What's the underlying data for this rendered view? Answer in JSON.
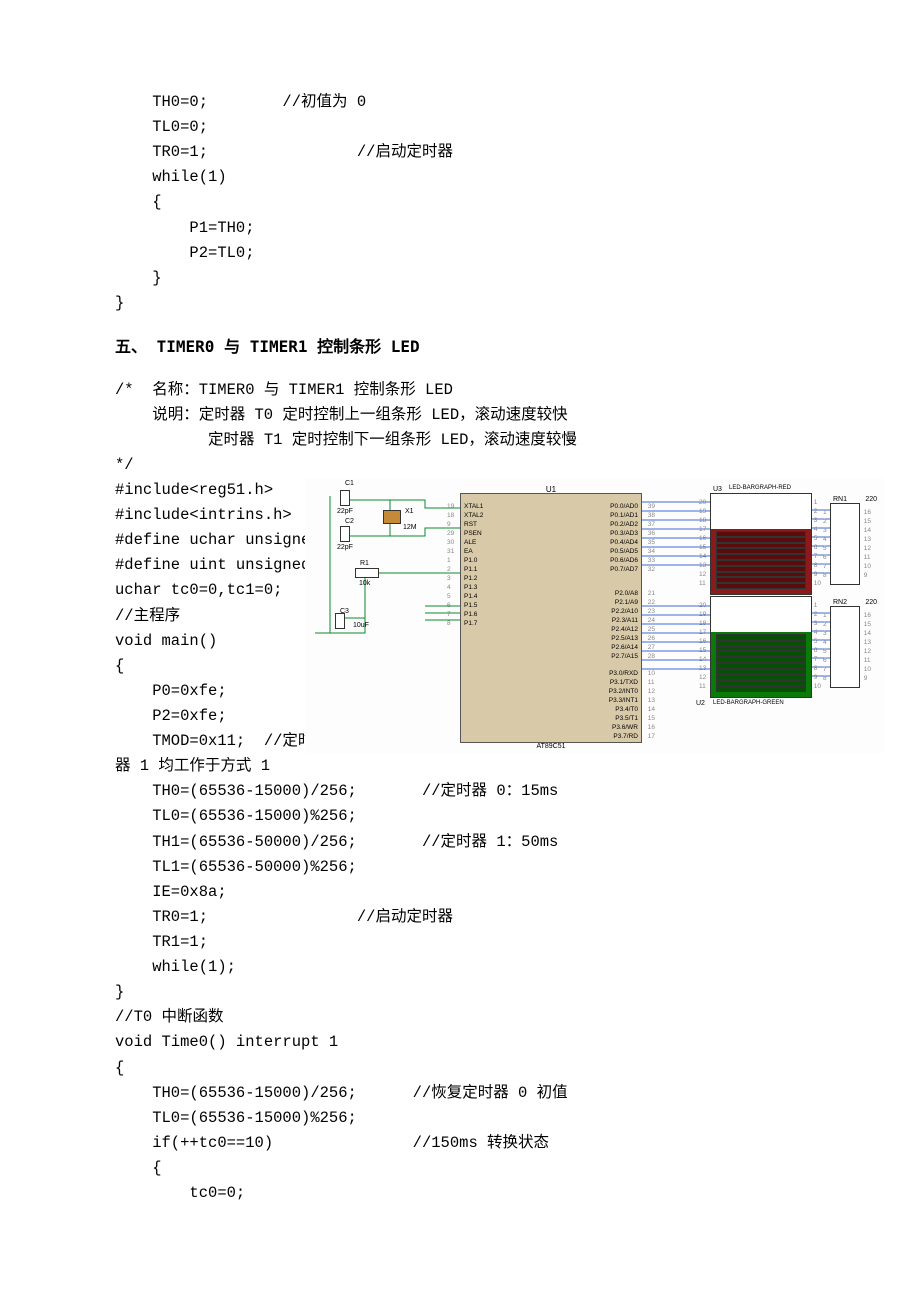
{
  "code_top": "    TH0=0;        //初值为 0\n    TL0=0;\n    TR0=1;                //启动定时器\n    while(1)\n    {\n        P1=TH0;\n        P2=TL0;\n    }\n}",
  "heading": "五、  TIMER0 与 TIMER1 控制条形 LED",
  "code_header": "/*  名称：TIMER0 与 TIMER1 控制条形 LED\n    说明：定时器 T0 定时控制上一组条形 LED，滚动速度较快\n          定时器 T1 定时控制下一组条形 LED，滚动速度较慢\n*/",
  "code_mid_left": "#include<reg51.h>\n#include<intrins.h>\n#define uchar unsigned char\n#define uint unsigned int\nuchar tc0=0,tc1=0;\n//主程序\nvoid main()\n{\n    P0=0xfe;\n    P2=0xfe;\n    TMOD=0x11;  //定时器 0、定时\n器 1 均工作于方式 1",
  "code_bottom": "    TH0=(65536-15000)/256;       //定时器 0：15ms\n    TL0=(65536-15000)%256;\n    TH1=(65536-50000)/256;       //定时器 1：50ms\n    TL1=(65536-50000)%256;\n    IE=0x8a;\n    TR0=1;                //启动定时器\n    TR1=1;\n    while(1);\n}\n//T0 中断函数\nvoid Time0() interrupt 1\n{\n    TH0=(65536-15000)/256;      //恢复定时器 0 初值\n    TL0=(65536-15000)%256;\n    if(++tc0==10)               //150ms 转换状态\n    {\n        tc0=0;",
  "schematic": {
    "mcu": {
      "ref": "U1",
      "name": "AT89C51",
      "pins_left": [
        {
          "num": "19",
          "lbl": "XTAL1"
        },
        {
          "num": "",
          "lbl": ""
        },
        {
          "num": "18",
          "lbl": "XTAL2"
        },
        {
          "num": "",
          "lbl": ""
        },
        {
          "num": "",
          "lbl": ""
        },
        {
          "num": "9",
          "lbl": "RST"
        },
        {
          "num": "",
          "lbl": ""
        },
        {
          "num": "",
          "lbl": ""
        },
        {
          "num": "29",
          "lbl": "PSEN"
        },
        {
          "num": "30",
          "lbl": "ALE"
        },
        {
          "num": "31",
          "lbl": "EA"
        },
        {
          "num": "",
          "lbl": ""
        },
        {
          "num": "",
          "lbl": ""
        },
        {
          "num": "1",
          "lbl": "P1.0"
        },
        {
          "num": "2",
          "lbl": "P1.1"
        },
        {
          "num": "3",
          "lbl": "P1.2"
        },
        {
          "num": "4",
          "lbl": "P1.3"
        },
        {
          "num": "5",
          "lbl": "P1.4"
        },
        {
          "num": "6",
          "lbl": "P1.5"
        },
        {
          "num": "7",
          "lbl": "P1.6"
        },
        {
          "num": "8",
          "lbl": "P1.7"
        }
      ],
      "pins_right_upper": [
        {
          "num": "39",
          "lbl": "P0.0/AD0"
        },
        {
          "num": "38",
          "lbl": "P0.1/AD1"
        },
        {
          "num": "37",
          "lbl": "P0.2/AD2"
        },
        {
          "num": "36",
          "lbl": "P0.3/AD3"
        },
        {
          "num": "35",
          "lbl": "P0.4/AD4"
        },
        {
          "num": "34",
          "lbl": "P0.5/AD5"
        },
        {
          "num": "33",
          "lbl": "P0.6/AD6"
        },
        {
          "num": "32",
          "lbl": "P0.7/AD7"
        }
      ],
      "pins_right_mid": [
        {
          "num": "21",
          "lbl": "P2.0/A8"
        },
        {
          "num": "22",
          "lbl": "P2.1/A9"
        },
        {
          "num": "23",
          "lbl": "P2.2/A10"
        },
        {
          "num": "24",
          "lbl": "P2.3/A11"
        },
        {
          "num": "25",
          "lbl": "P2.4/A12"
        },
        {
          "num": "26",
          "lbl": "P2.5/A13"
        },
        {
          "num": "27",
          "lbl": "P2.6/A14"
        },
        {
          "num": "28",
          "lbl": "P2.7/A15"
        }
      ],
      "pins_right_lower": [
        {
          "num": "10",
          "lbl": "P3.0/RXD"
        },
        {
          "num": "11",
          "lbl": "P3.1/TXD"
        },
        {
          "num": "12",
          "lbl": "P3.2/INT0"
        },
        {
          "num": "13",
          "lbl": "P3.3/INT1"
        },
        {
          "num": "14",
          "lbl": "P3.4/T0"
        },
        {
          "num": "15",
          "lbl": "P3.5/T1"
        },
        {
          "num": "16",
          "lbl": "P3.6/WR"
        },
        {
          "num": "17",
          "lbl": "P3.7/RD"
        }
      ]
    },
    "comps": {
      "c1": "C1",
      "c1v": "22pF",
      "c2": "C2",
      "c2v": "22pF",
      "c3": "C3",
      "c3v": "10uF",
      "x1": "X1",
      "x1v": "12M",
      "r1": "R1",
      "r1v": "10k"
    },
    "bargraph_red": {
      "ref": "U3",
      "name": "LED-BARGRAPH-RED"
    },
    "bargraph_green": {
      "ref": "U2",
      "name": "LED-BARGRAPH-GREEN"
    },
    "rn1": {
      "ref": "RN1",
      "val": "220"
    },
    "rn2": {
      "ref": "RN2",
      "val": "220"
    },
    "bar_nums_left": [
      "20",
      "19",
      "18",
      "17",
      "16",
      "15",
      "14",
      "13",
      "12",
      "11"
    ],
    "bar_nums_right": [
      "1",
      "2",
      "3",
      "4",
      "5",
      "6",
      "7",
      "8",
      "9",
      "10"
    ],
    "rn_nums_left": [
      "1",
      "2",
      "3",
      "4",
      "5",
      "6",
      "7",
      "8"
    ],
    "rn_nums_right": [
      "16",
      "15",
      "14",
      "13",
      "12",
      "11",
      "10",
      "9"
    ]
  }
}
